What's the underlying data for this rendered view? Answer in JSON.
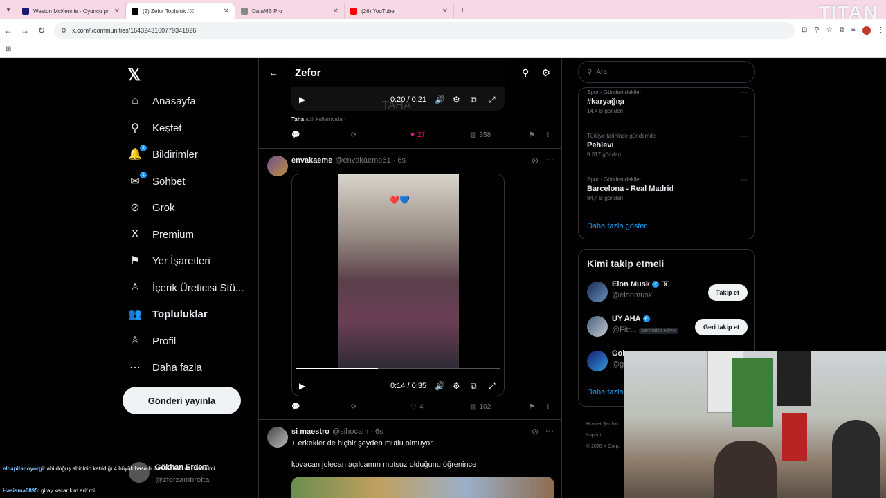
{
  "browser": {
    "tabs": [
      {
        "title": "Weston McKennie - Oyuncu pr",
        "favicon_color": "#1a1a6e",
        "active": false
      },
      {
        "title": "(2) Zefor Topluluk / X",
        "favicon_color": "#000000",
        "active": true
      },
      {
        "title": "DataMB Pro",
        "favicon_color": "#888888",
        "active": false
      },
      {
        "title": "(26) YouTube",
        "favicon_color": "#ff0000",
        "active": false
      }
    ],
    "url": "x.com/i/communities/1643243160779341826",
    "watermark": "TITAN"
  },
  "nav": {
    "items": [
      {
        "label": "Anasayfa",
        "icon": "home-icon",
        "glyph": "⌂"
      },
      {
        "label": "Keşfet",
        "icon": "search-icon",
        "glyph": "⚲"
      },
      {
        "label": "Bildirimler",
        "icon": "bell-icon",
        "glyph": "🔔",
        "badge": "1"
      },
      {
        "label": "Sohbet",
        "icon": "mail-icon",
        "glyph": "✉",
        "badge": "1"
      },
      {
        "label": "Grok",
        "icon": "grok-icon",
        "glyph": "⊘"
      },
      {
        "label": "Premium",
        "icon": "x-icon",
        "glyph": "X"
      },
      {
        "label": "Yer İşaretleri",
        "icon": "bookmark-icon",
        "glyph": "⚑"
      },
      {
        "label": "İçerik Üreticisi Stü...",
        "icon": "creator-icon",
        "glyph": "♙"
      },
      {
        "label": "Topluluklar",
        "icon": "communities-icon",
        "glyph": "👥"
      },
      {
        "label": "Profil",
        "icon": "profile-icon",
        "glyph": "♙"
      },
      {
        "label": "Daha fazla",
        "icon": "more-icon",
        "glyph": "⋯"
      }
    ],
    "post_button": "Gönderi yayınla"
  },
  "header": {
    "title": "Zefor"
  },
  "posts": [
    {
      "video_time": "0:20 / 0:21",
      "video_caption": "TAHA",
      "note_user": "Taha",
      "note_text": "adlı kullanıcıdan",
      "likes": "27",
      "views": "358"
    },
    {
      "name": "envakaeme",
      "handle": "@envakaeme61 · 6s",
      "video_time": "0:14 / 0:35",
      "hearts": "❤️💙",
      "likes": "4",
      "views": "102"
    },
    {
      "name": "si maestro",
      "handle": "@sihocam · 6s",
      "text1": "+ erkekler de hiçbir şeyden mutlu olmuyor",
      "text2": "kovacan jolecan açılcamın mutsuz olduğunu öğrenince"
    }
  ],
  "right": {
    "search_placeholder": "Ara",
    "trends": [
      {
        "context": "Spor · Gündemdekiler",
        "title": "#karyağışı",
        "count": "14,4 B gönderi"
      },
      {
        "context": "Türkiye tarihinde gündemde",
        "title": "Pehlevi",
        "count": "9.317 gönderi"
      },
      {
        "context": "Spor · Gündemdekiler",
        "title": "Barcelona - Real Madrid",
        "count": "84,4 B gönderi"
      }
    ],
    "show_more": "Daha fazla göster",
    "who_title": "Kimi takip etmeli",
    "who": [
      {
        "name": "Elon Musk",
        "handle": "@elonmusk",
        "button": "Takip et"
      },
      {
        "name": "UY AHA",
        "handle": "@Fitr...",
        "tag": "Seni takip ediyor",
        "button": "Geri takip et"
      },
      {
        "name": "Gol",
        "handle": "@g"
      }
    ],
    "show_more2": "Daha fazla",
    "footer": [
      "Hizmet Şartları",
      "Imprint",
      "© 2026 X Corp."
    ]
  },
  "chat": [
    {
      "user": "elcapitanoyorgi",
      "text": ": abi doğuş abininin katıldığı 4 büyük basa bulunulan tabi uz izledin mi"
    },
    {
      "user": "Hasisma6895",
      "text": ": giray kacar kim arif mi"
    }
  ],
  "overlay": {
    "name": "Gökhan Erdem",
    "handle": "@zforzambrotta"
  }
}
